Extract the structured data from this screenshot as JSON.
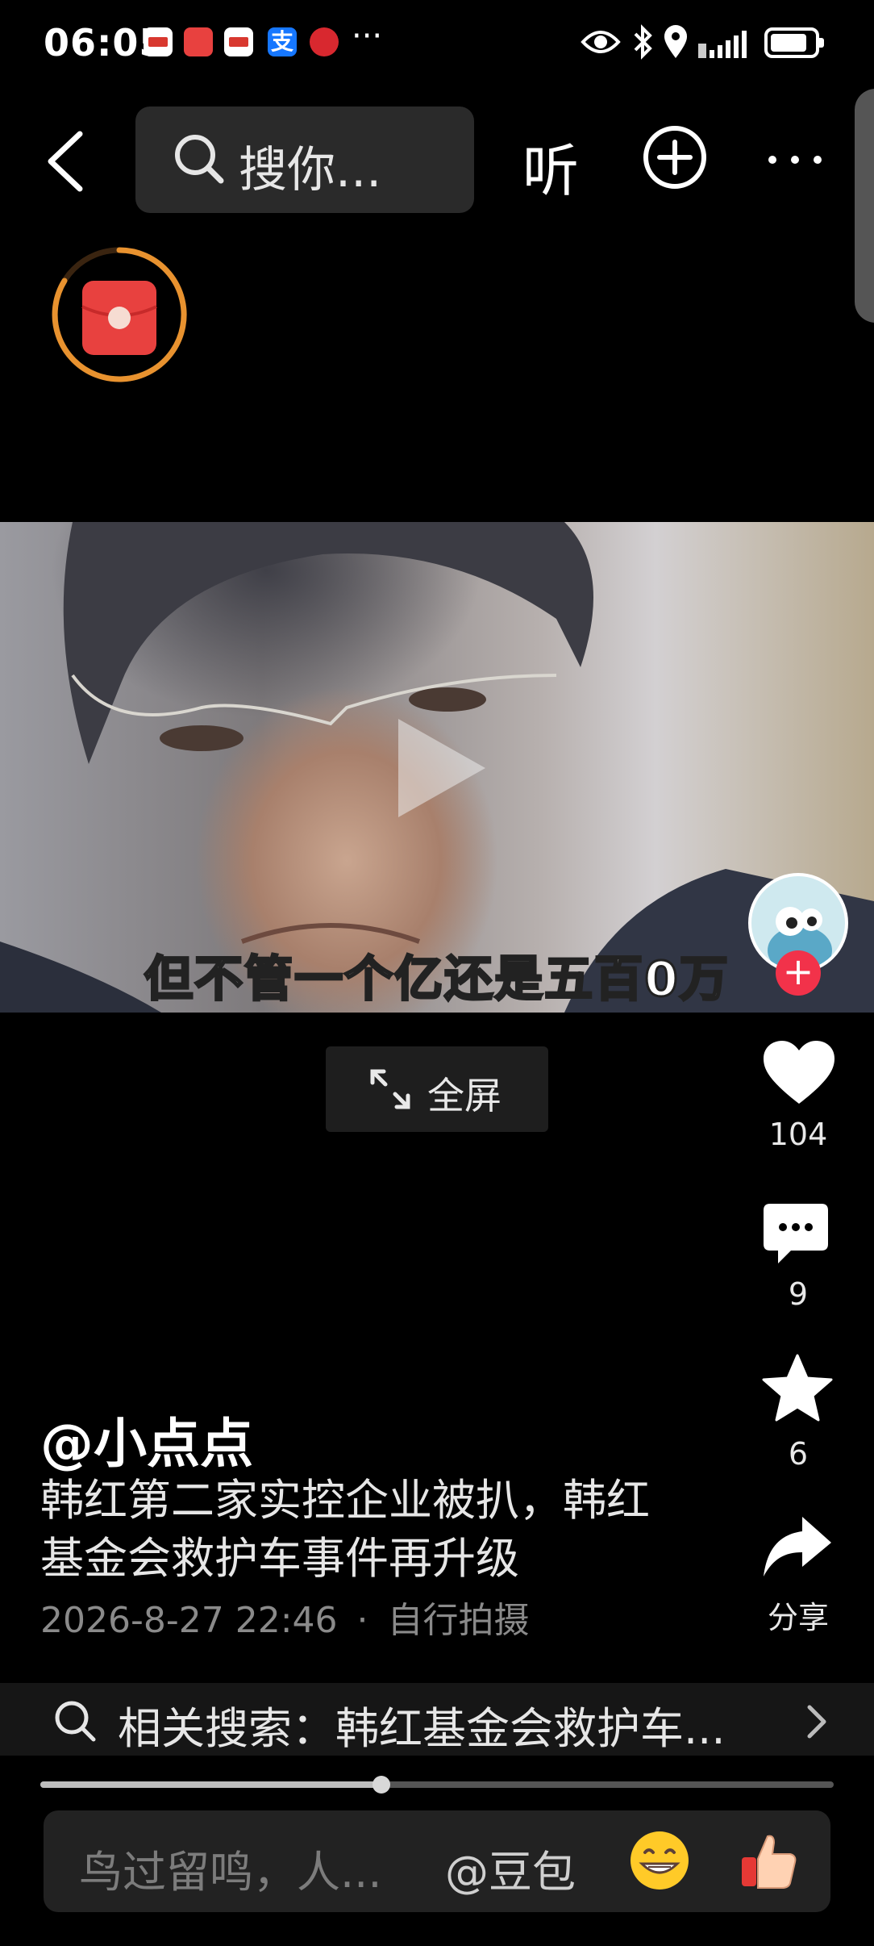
{
  "status_bar": {
    "time": "06:05",
    "more": "···",
    "icons": [
      "huawei-app-icon",
      "alipay-icon",
      "eye-icon",
      "bluetooth-icon",
      "location-icon",
      "signal-icon",
      "battery-icon"
    ]
  },
  "nav": {
    "search_placeholder": "搜你...",
    "listen_label": "听"
  },
  "video": {
    "subtitle": "但不管一个亿还是五百0万"
  },
  "fullscreen_label": "全屏",
  "actions": {
    "like_count": "104",
    "comment_count": "9",
    "favorite_count": "6",
    "share_label": "分享"
  },
  "post": {
    "author": "@小点点",
    "description": "韩红第二家实控企业被扒，韩红基金会救护车事件再升级",
    "date": "2026-8-27 22:46",
    "separator": "·",
    "source": "自行拍摄"
  },
  "related_search": {
    "text": "相关搜索：韩红基金会救护车..."
  },
  "playback": {
    "progress": 0.43
  },
  "comment_bar": {
    "placeholder": "鸟过留鸣，人...",
    "mention": "@豆包"
  },
  "colors": {
    "background": "#000000",
    "follow_red": "#f2324a",
    "ring_orange": "#e8922f",
    "packet_red": "#e8413f"
  }
}
